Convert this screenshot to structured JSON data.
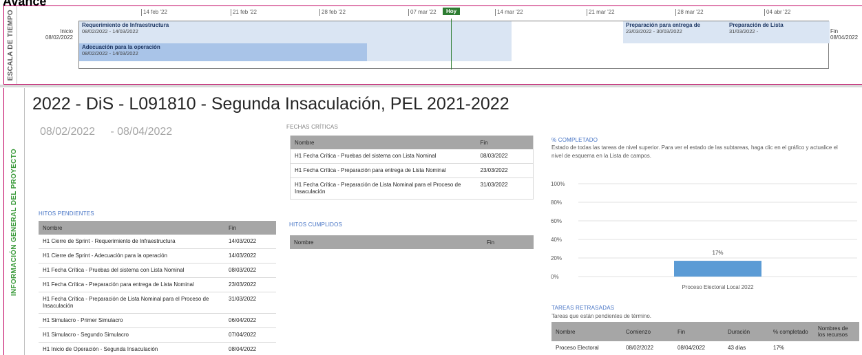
{
  "page": {
    "title": "Avance"
  },
  "timeline": {
    "side_label": "ESCALA DE TIEMPO",
    "today_label": "Hoy",
    "start_label": "Inicio",
    "start_date": "08/02/2022",
    "end_label": "Fin",
    "end_date": "08/04/2022",
    "ticks": [
      "14 feb '22",
      "21 feb '22",
      "28 feb '22",
      "07 mar '22",
      "14 mar '22",
      "21 mar '22",
      "28 mar '22",
      "04 abr '22"
    ],
    "bars": [
      {
        "name": "Requerimiento de Infraestructura",
        "dates": "08/02/2022 - 14/03/2022"
      },
      {
        "name": "Adecuación para la operación",
        "dates": "08/02/2022 - 14/03/2022"
      }
    ],
    "tasks": [
      {
        "name": "Preparación para entrega de",
        "dates": "23/03/2022 - 30/03/2022"
      },
      {
        "name": "Preparación de Lista",
        "dates": "31/03/2022 -"
      }
    ]
  },
  "project": {
    "side_label": "INFORMACIÓN GENERAL DEL PROYECTO",
    "title": "2022 - DiS - L091810 - Segunda Insaculación, PEL 2021-2022",
    "start": "08/02/2022",
    "end": "- 08/04/2022"
  },
  "critical_dates": {
    "label": "FECHAS CRÍTICAS",
    "headers": {
      "name": "Nombre",
      "end": "Fin"
    },
    "rows": [
      {
        "name": "H1 Fecha Crítica - Pruebas del sistema con Lista Nominal",
        "end": "08/03/2022"
      },
      {
        "name": "H1 Fecha Crítica - Preparación para entrega de Lista Nominal",
        "end": "23/03/2022"
      },
      {
        "name": "H1 Fecha Crítica - Preparación de Lista Nominal para el Proceso de Insaculación",
        "end": "31/03/2022"
      }
    ]
  },
  "pending_milestones": {
    "label": "HITOS PENDIENTES",
    "headers": {
      "name": "Nombre",
      "end": "Fin"
    },
    "rows": [
      {
        "name": "H1 Cierre de Sprint - Requerimiento de Infraestructura",
        "end": "14/03/2022"
      },
      {
        "name": "H1 Cierre de Sprint - Adecuación para la operación",
        "end": "14/03/2022"
      },
      {
        "name": "H1 Fecha Crítica - Pruebas del sistema con Lista Nominal",
        "end": "08/03/2022"
      },
      {
        "name": "H1 Fecha Crítica - Preparación para entrega de Lista Nominal",
        "end": "23/03/2022"
      },
      {
        "name": "H1 Fecha Crítica - Preparación de Lista Nominal para el Proceso de Insaculación",
        "end": "31/03/2022"
      },
      {
        "name": "H1 Simulacro - Primer Simulacro",
        "end": "06/04/2022"
      },
      {
        "name": "H1 Simulacro - Segundo Simulacro",
        "end": "07/04/2022"
      },
      {
        "name": "H1 Inicio de Operación - Segunda Insaculación",
        "end": "08/04/2022"
      }
    ]
  },
  "completed_milestones": {
    "label": "HITOS CUMPLIDOS",
    "headers": {
      "name": "Nombre",
      "end": "Fin"
    }
  },
  "percent_complete": {
    "label": "% COMPLETADO",
    "description": "Estado de todas las tareas de nivel superior. Para ver el estado de las subtareas, haga clic en el gráfico y actualice el nivel de esquema en la Lista de campos."
  },
  "chart_data": {
    "type": "bar",
    "categories": [
      "Proceso Electoral Local 2022"
    ],
    "values": [
      17
    ],
    "data_labels": [
      "17%"
    ],
    "ylim": [
      0,
      100
    ],
    "yticks": [
      "0%",
      "20%",
      "40%",
      "60%",
      "80%",
      "100%"
    ],
    "bar_color": "#5b9bd5",
    "grid": true
  },
  "late_tasks": {
    "label": "TAREAS RETRASADAS",
    "description": "Tareas que están pendientes de término.",
    "headers": {
      "name": "Nombre",
      "start": "Comienzo",
      "end": "Fin",
      "duration": "Duración",
      "pct": "% completado",
      "resources": "Nombres de los recursos"
    },
    "rows": [
      {
        "name": "Proceso Electoral",
        "start": "08/02/2022",
        "end": "08/04/2022",
        "duration": "43 días",
        "pct": "17%",
        "resources": ""
      }
    ]
  },
  "colors": {
    "accent": "#c00060",
    "today": "#2e7d32",
    "bar_light": "#dae5f3",
    "bar_mid": "#a9c4e8",
    "header_gray": "#a6a6a6",
    "link_blue": "#4472c4"
  }
}
